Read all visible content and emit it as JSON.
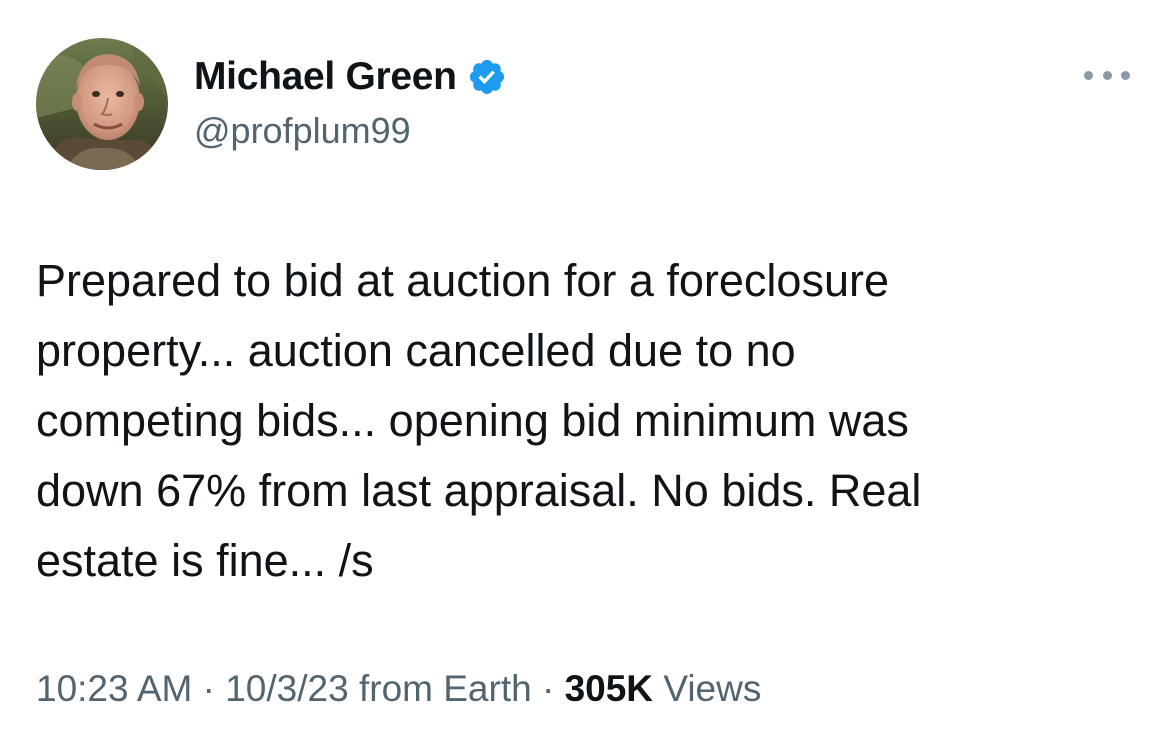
{
  "user": {
    "display_name": "Michael Green",
    "handle": "@profplum99",
    "verified": true,
    "verified_color": "#1d9bf0"
  },
  "menu": {
    "icon": "more-horizontal-icon"
  },
  "tweet": {
    "text": "Prepared to bid at auction for a foreclosure\nproperty... auction cancelled due to no\ncompeting bids... opening bid minimum was\ndown 67% from last appraisal. No bids. Real\nestate is fine... /s"
  },
  "meta": {
    "time": "10:23 AM",
    "separator": "·",
    "date": "10/3/23",
    "source": "from Earth",
    "views_count": "305K",
    "views_label": "Views"
  },
  "colors": {
    "primary_text": "#0f1419",
    "secondary_text": "#536471",
    "background": "#ffffff"
  }
}
